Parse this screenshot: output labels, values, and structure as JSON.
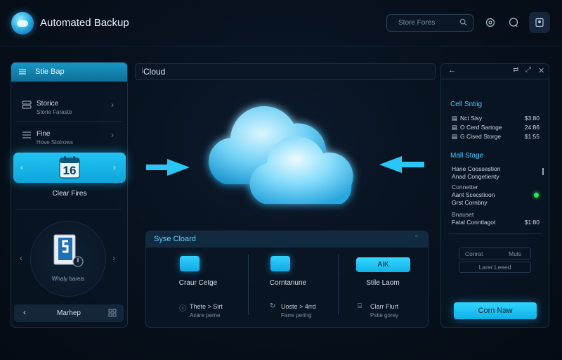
{
  "header": {
    "title": "Automated Backup",
    "search_placeholder": "Store Fores"
  },
  "left_panel": {
    "title": "Stie Bap",
    "items": [
      {
        "title": "Storice",
        "subtitle": "Storie Farasto"
      },
      {
        "title": "Fine",
        "subtitle": "Hove Stotrows"
      }
    ],
    "active_badge": "16",
    "active_label": "Clear Fires",
    "disk_label": "Whaly bareis",
    "bottom_label": "Marhep"
  },
  "center": {
    "cloud_title": "Cloud",
    "sync_title": "Syse Cloard",
    "columns": [
      {
        "title": "Craur Cetge",
        "line1": "Thete > Sirt",
        "line2": "Axare perne"
      },
      {
        "title": "Corntanune",
        "line1": "Uoste > 4rrd",
        "line2": "Farre pering"
      },
      {
        "title": "Stile Laom",
        "line1": "Clarr Flurt",
        "line2": "Pstie gorey",
        "button": "AIK"
      }
    ]
  },
  "right_panel": {
    "section1_title": "Cell Sntiig",
    "rows1": [
      {
        "label": "Nct Sisy",
        "value": "$3:80"
      },
      {
        "label": "O Cerd Sartoge",
        "value": "24:86"
      },
      {
        "label": "G Cised Storge",
        "value": "$1:55"
      }
    ],
    "section2_title": "Mall Stage",
    "section2_lines": [
      "Hane Coossestion",
      "Anad Congetienty"
    ],
    "section3_title": "Connetter",
    "section3_lines": [
      "Aant Scecstioon",
      "Grst Cornbny"
    ],
    "section4_title": "Bnauset",
    "section4_row": {
      "label": "Fatal Conntlagot",
      "value": "$1:80"
    },
    "btn1_left": "Conrat",
    "btn1_right": "Muls",
    "btn2": "Larer Leeed",
    "confirm": "Corn Naw"
  },
  "colors": {
    "accent": "#1ec3f4",
    "background": "#07101c",
    "panel_border": "#173048"
  }
}
